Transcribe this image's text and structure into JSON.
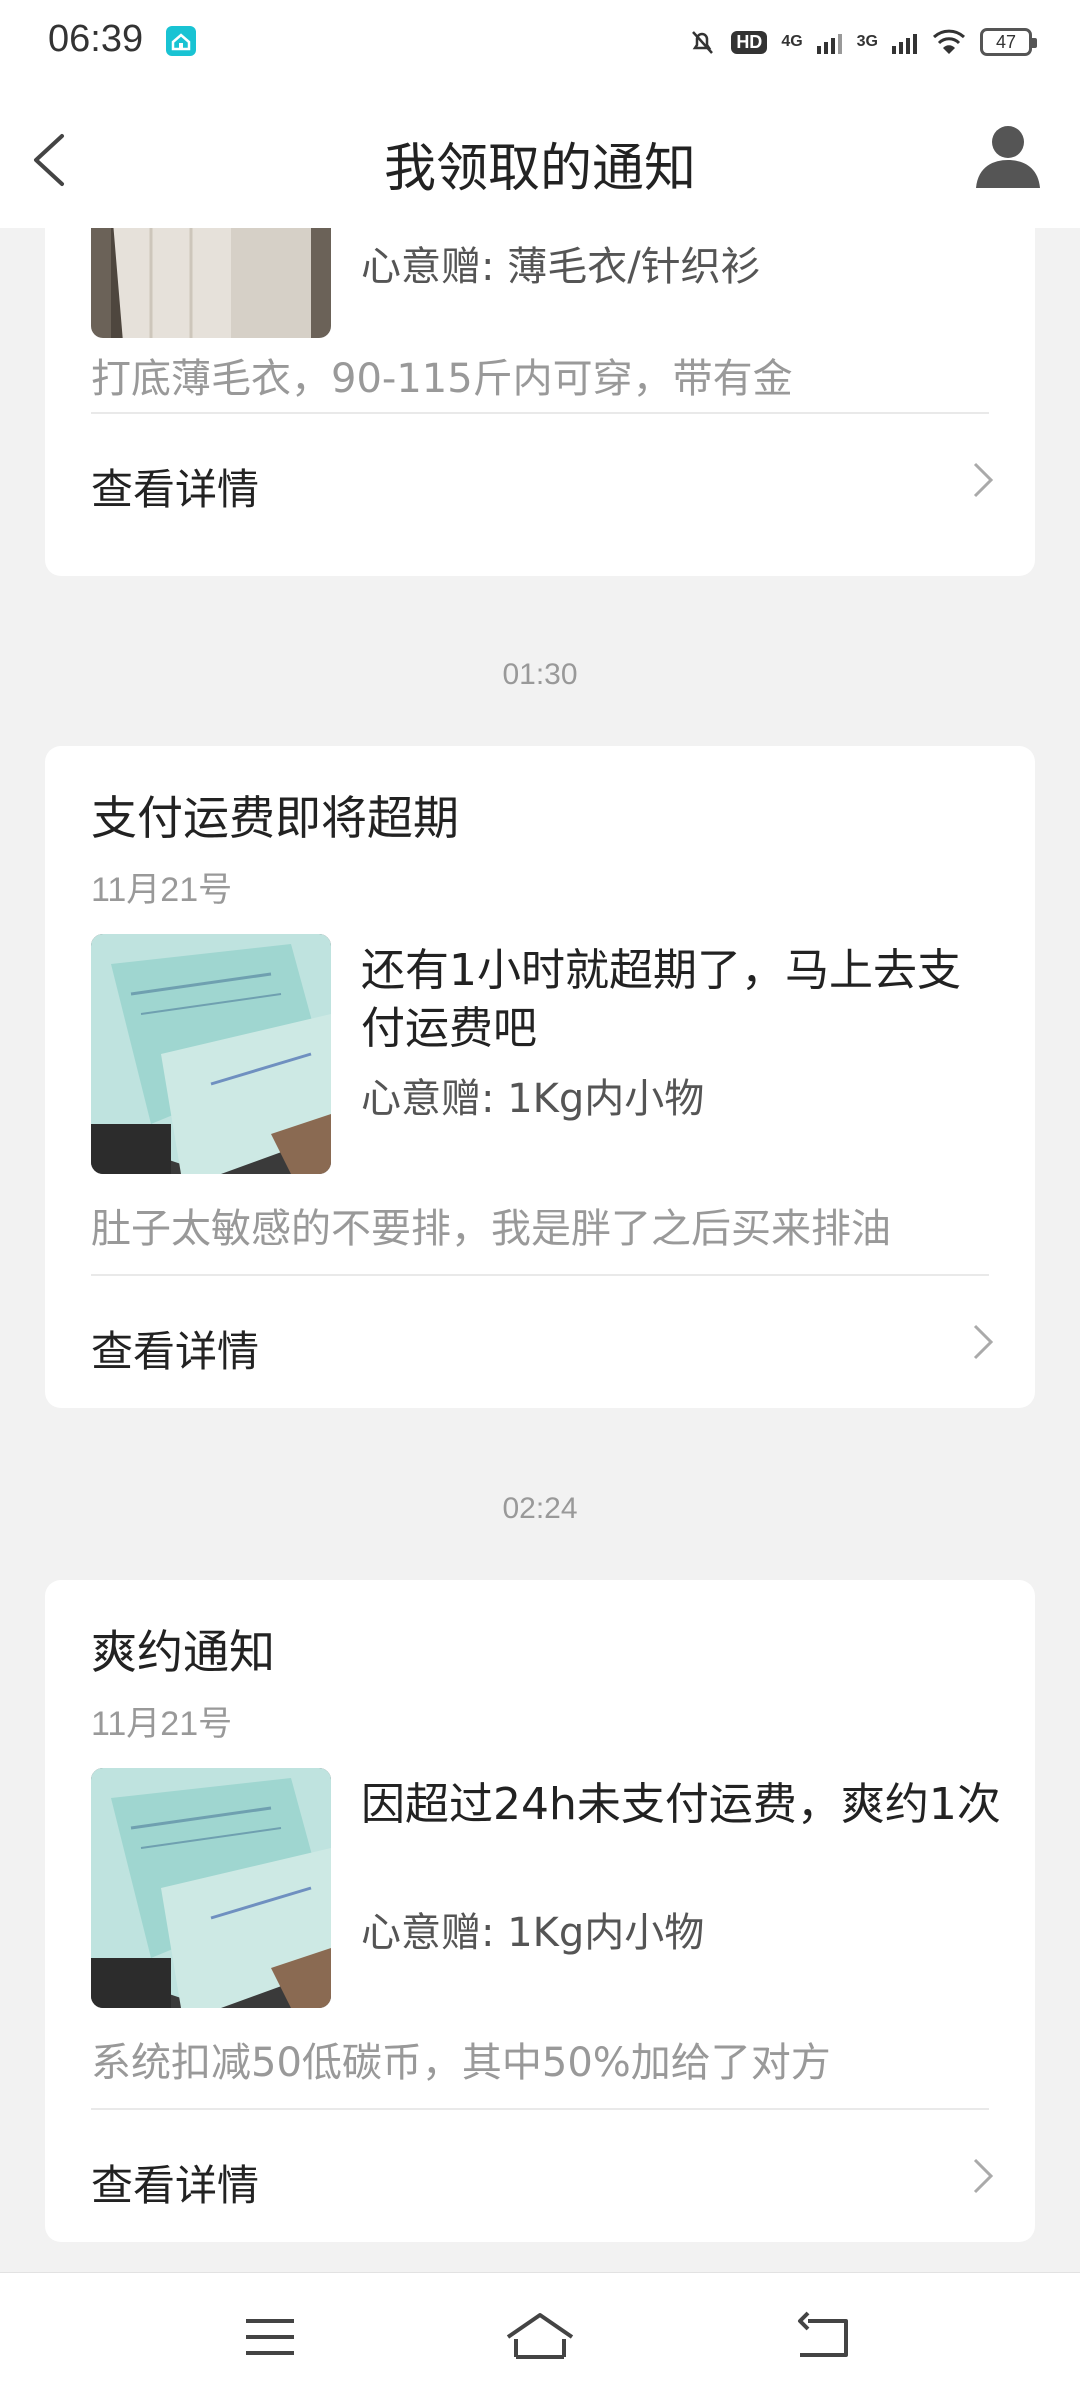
{
  "status_bar": {
    "time": "06:39",
    "net_4g": "4G",
    "net_3g": "3G",
    "hd_badge": "HD",
    "battery": "47"
  },
  "header": {
    "title": "我领取的通知"
  },
  "cards": [
    {
      "gift": "心意赠: 薄毛衣/针织衫",
      "desc": "打底薄毛衣，90-115斤内可穿，带有金",
      "detail": "查看详情"
    },
    {
      "title": "支付运费即将超期",
      "date": "11月21号",
      "message": "还有1小时就超期了，马上去支付运费吧",
      "gift": "心意赠: 1Kg内小物",
      "desc": "肚子太敏感的不要排，我是胖了之后买来排油",
      "detail": "查看详情"
    },
    {
      "title": "爽约通知",
      "date": "11月21号",
      "message": "因超过24h未支付运费，爽约1次",
      "gift": "心意赠: 1Kg内小物",
      "desc": "系统扣减50低碳币，其中50%加给了对方",
      "detail": "查看详情"
    }
  ],
  "time_separators": [
    "01:30",
    "02:24"
  ],
  "icons": {
    "back": "back-arrow-icon",
    "profile": "user-profile-icon",
    "chevron": "chevron-right-icon",
    "menu": "menu-icon",
    "home": "home-icon",
    "nav_back": "back-icon"
  },
  "colors": {
    "background": "#f2f2f2",
    "card": "#ffffff",
    "muted_text": "#999999",
    "accent_app_icon": "#19c3d3"
  }
}
